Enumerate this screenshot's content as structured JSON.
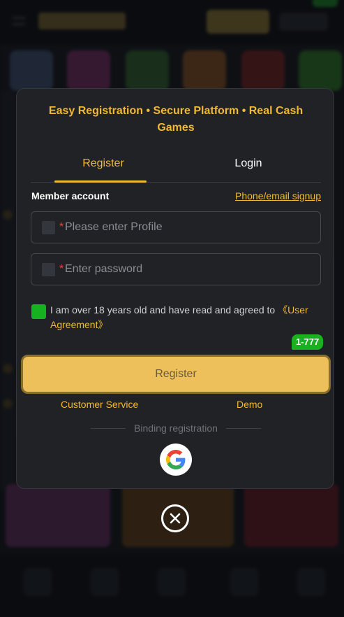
{
  "modal": {
    "headline": "Easy Registration • Secure Platform • Real Cash Games",
    "tabs": {
      "register": "Register",
      "login": "Login"
    },
    "member_label": "Member account",
    "alt_signup_link": "Phone/email signup",
    "profile_field": {
      "required_mark": "*",
      "placeholder": "Please enter Profile"
    },
    "password_field": {
      "required_mark": "*",
      "placeholder": "Enter password"
    },
    "agreement": {
      "text": "I am over 18 years old and have read and agreed to ",
      "link": "《User Agreement》",
      "checked": true
    },
    "badge": "1-777",
    "register_button": "Register",
    "customer_service_link": "Customer Service",
    "demo_link": "Demo",
    "binding_label": "Binding registration",
    "social_login": [
      "google-icon"
    ]
  },
  "colors": {
    "accent": "#f2b933",
    "register_button": "#eec05c",
    "check_green": "#17b21f",
    "modal_bg": "#202226"
  }
}
